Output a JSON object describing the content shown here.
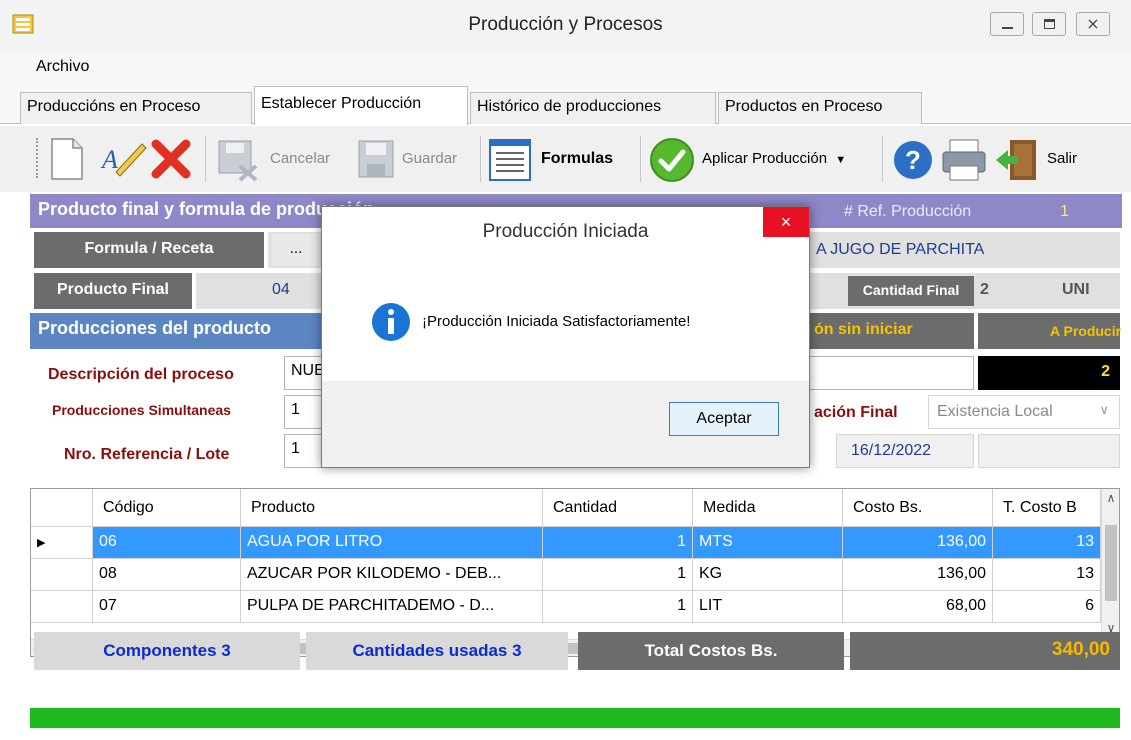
{
  "window": {
    "title": "Producción y Procesos"
  },
  "menu": {
    "archivo": "Archivo"
  },
  "tabs": [
    "Produccións en Proceso",
    "Establecer Producción",
    "Histórico de producciones",
    "Productos en Proceso"
  ],
  "toolbar": {
    "cancelar": "Cancelar",
    "guardar": "Guardar",
    "formulas": "Formulas",
    "aplicar": "Aplicar Producción",
    "salir": "Salir"
  },
  "header": {
    "title": "Producto final y formula de producción",
    "ref_label": "# Ref. Producción",
    "ref_value": "1"
  },
  "form": {
    "formula_label": "Formula / Receta",
    "formula_btn": "...",
    "formula_name": "A JUGO DE PARCHITA",
    "producto_final_label": "Producto Final",
    "producto_final_code": "04",
    "cantidad_final_label": "Cantidad Final",
    "cantidad_final_value": "2",
    "unit": "UNI",
    "producciones_title": "Producciones del producto",
    "estado": "ón sin iniciar",
    "a_producir_label": "A Producir",
    "a_producir_value": "2",
    "descripcion_label": "Descripción del proceso",
    "descripcion_value": "NUE",
    "simultaneas_label": "Producciones Simultaneas",
    "simultaneas_value": "1",
    "ubicacion_label": "ación Final",
    "ubicacion_value": "Existencia Local",
    "referencia_label": "Nro. Referencia / Lote",
    "referencia_value": "1",
    "fecha": "16/12/2022"
  },
  "grid": {
    "columns": [
      "Código",
      "Producto",
      "Cantidad",
      "Medida",
      "Costo Bs.",
      "T. Costo B"
    ],
    "rows": [
      {
        "codigo": "06",
        "producto": "AGUA POR LITRO",
        "cantidad": "1",
        "medida": "MTS",
        "costo": "136,00",
        "tcosto": "13"
      },
      {
        "codigo": "08",
        "producto": "AZUCAR POR KILODEMO - DEB...",
        "cantidad": "1",
        "medida": "KG",
        "costo": "136,00",
        "tcosto": "13"
      },
      {
        "codigo": "07",
        "producto": "PULPA DE PARCHITADEMO - D...",
        "cantidad": "1",
        "medida": "LIT",
        "costo": "68,00",
        "tcosto": "6"
      }
    ]
  },
  "summary": {
    "componentes": "Componentes 3",
    "cantidades": "Cantidades usadas 3",
    "total_label": "Total Costos Bs.",
    "total_value": "340,00"
  },
  "dialog": {
    "title": "Producción Iniciada",
    "message": "¡Producción Iniciada Satisfactoriamente!",
    "ok": "Aceptar",
    "close": "×"
  },
  "colors": {
    "header_band": "#8e88c8",
    "section_band": "#5b86c2",
    "selected_row": "#3399ff",
    "progress": "#1fba1f",
    "total_value": "#f5b800"
  }
}
